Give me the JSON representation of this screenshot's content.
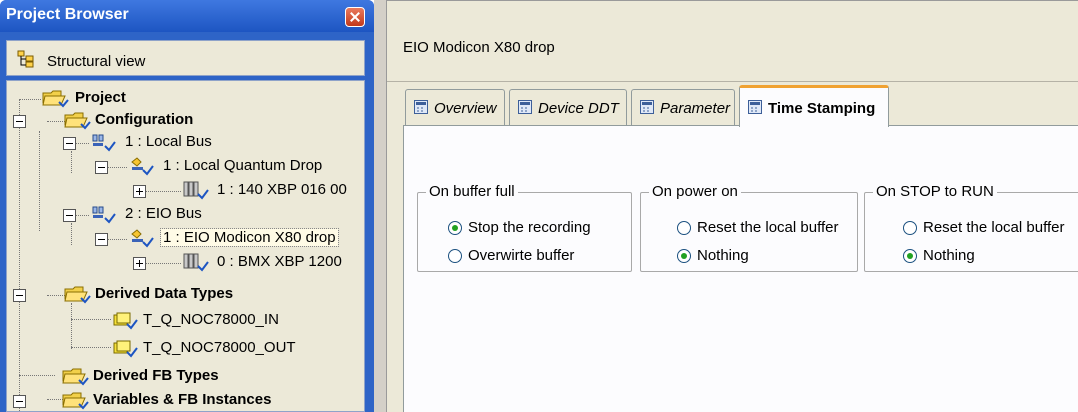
{
  "browser": {
    "title": "Project Browser",
    "view": "Structural view",
    "tree": {
      "project": "Project",
      "configuration": "Configuration",
      "local_bus": "1 : Local Bus",
      "local_quantum_drop": "1 : Local Quantum Drop",
      "rack_140": "1 : 140 XBP 016 00",
      "eio_bus": "2 : EIO Bus",
      "eio_drop": "1 : EIO Modicon X80 drop",
      "rack_bmx": "0 : BMX XBP 1200",
      "derived_data_types": "Derived Data Types",
      "ddt_in": "T_Q_NOC78000_IN",
      "ddt_out": "T_Q_NOC78000_OUT",
      "derived_fb_types": "Derived FB Types",
      "variables": "Variables & FB Instances"
    }
  },
  "editor": {
    "title": "EIO Modicon X80 drop",
    "tabs": [
      "Overview",
      "Device DDT",
      "Parameter",
      "Time Stamping"
    ],
    "active_tab": "Time Stamping",
    "groups": [
      {
        "legend": "On buffer full",
        "options": [
          {
            "label": "Stop the recording",
            "checked": true
          },
          {
            "label": "Overwirte buffer",
            "checked": false
          }
        ]
      },
      {
        "legend": "On power on",
        "options": [
          {
            "label": "Reset the local buffer",
            "checked": false
          },
          {
            "label": "Nothing",
            "checked": true
          }
        ]
      },
      {
        "legend": "On STOP to RUN",
        "options": [
          {
            "label": "Reset the local buffer",
            "checked": false
          },
          {
            "label": "Nothing",
            "checked": true
          }
        ]
      }
    ]
  },
  "colors": {
    "title_bar": "#1d55c2",
    "panel_bg": "#ece9d8",
    "active_tab_accent": "#f0a232",
    "radio_check": "#21a121"
  },
  "icons": [
    "close-icon",
    "structural-view-icon",
    "folder-icon",
    "bus-icon",
    "drop-icon",
    "rack-icon",
    "ddt-icon",
    "tab-page-icon"
  ]
}
